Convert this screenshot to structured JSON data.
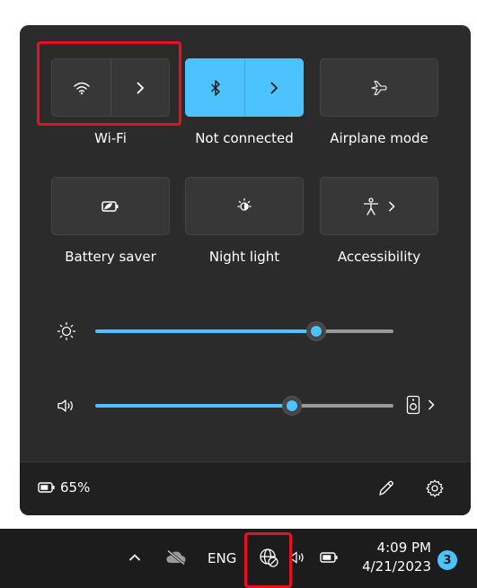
{
  "quick_settings": {
    "tiles": [
      {
        "id": "wifi",
        "label": "Wi-Fi",
        "active": false,
        "icon": "wifi-icon",
        "has_expand": true
      },
      {
        "id": "bluetooth",
        "label": "Not connected",
        "active": true,
        "icon": "bluetooth-icon",
        "has_expand": true
      },
      {
        "id": "airplane",
        "label": "Airplane mode",
        "active": false,
        "icon": "airplane-icon",
        "has_expand": false
      },
      {
        "id": "battery_saver",
        "label": "Battery saver",
        "active": false,
        "icon": "battery-saver-icon",
        "has_expand": false
      },
      {
        "id": "night_light",
        "label": "Night light",
        "active": false,
        "icon": "night-light-icon",
        "has_expand": false
      },
      {
        "id": "accessibility",
        "label": "Accessibility",
        "active": false,
        "icon": "accessibility-icon",
        "has_expand": true
      }
    ],
    "brightness": {
      "icon": "brightness-icon",
      "level": 0.74
    },
    "volume": {
      "icon": "speaker-icon",
      "level": 0.66,
      "output_icon": "audio-output-icon"
    },
    "footer": {
      "battery_percent": "65%",
      "battery_icon": "battery-icon",
      "edit_icon": "pencil-icon",
      "settings_icon": "gear-icon"
    }
  },
  "taskbar": {
    "input_language": "ENG",
    "time": "4:09 PM",
    "date": "4/21/2023",
    "notification_count": "3",
    "icons": [
      "chevron-up-icon",
      "cloud-off-icon",
      "network-globe-icon",
      "volume-icon",
      "battery-icon"
    ]
  },
  "colors": {
    "accent": "#4cc2ff",
    "panel_bg": "#2b2b2b",
    "taskbar_bg": "#1c1c1c",
    "highlight": "#e81123"
  }
}
